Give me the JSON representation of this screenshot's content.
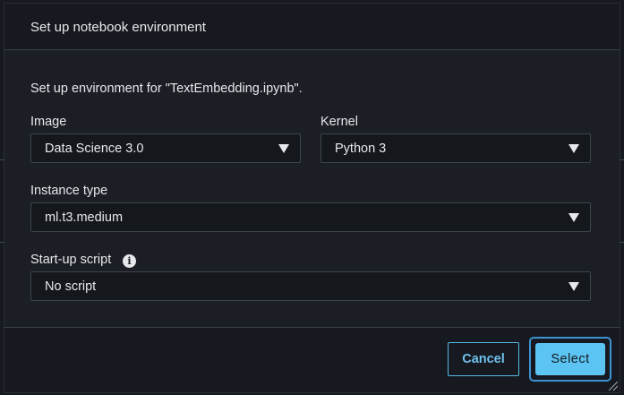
{
  "dialog": {
    "title": "Set up notebook environment",
    "description": "Set up environment for \"TextEmbedding.ipynb\".",
    "image": {
      "label": "Image",
      "value": "Data Science 3.0"
    },
    "kernel": {
      "label": "Kernel",
      "value": "Python 3"
    },
    "instance_type": {
      "label": "Instance type",
      "value": "ml.t3.medium"
    },
    "startup_script": {
      "label": "Start-up script",
      "value": "No script",
      "info_icon": "info-icon"
    },
    "buttons": {
      "cancel": "Cancel",
      "select": "Select"
    }
  },
  "colors": {
    "accent": "#5cc4f2",
    "background": "#16191f",
    "panel": "#1b1e24"
  }
}
